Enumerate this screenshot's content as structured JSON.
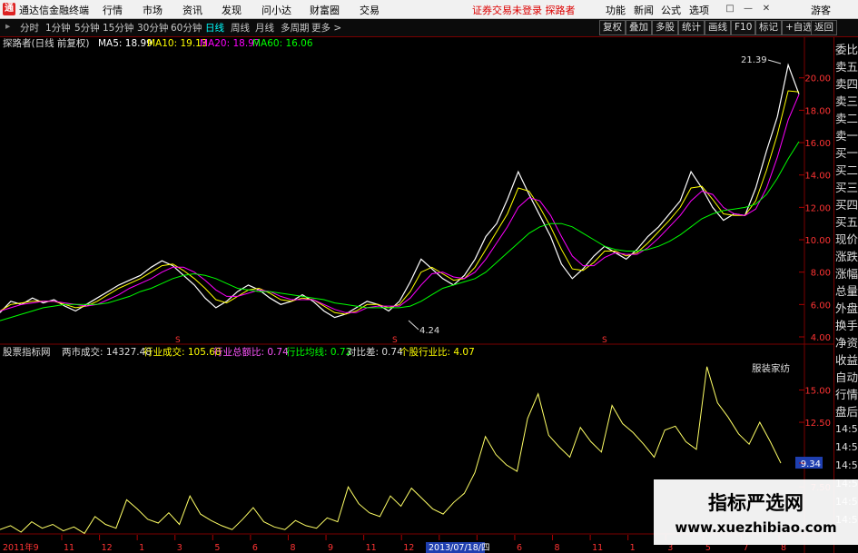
{
  "app": {
    "logo_char": "通",
    "name": "通达信金融终端"
  },
  "menu": [
    "行情",
    "市场",
    "资讯",
    "发现",
    "问小达",
    "财富圈",
    "交易"
  ],
  "notice": "证券交易未登录  探路者",
  "right_menu": [
    "功能",
    "新闻",
    "公式",
    "选项"
  ],
  "guest_label": "游客",
  "window_buttons": [
    "□",
    "—",
    "✕"
  ],
  "periods": [
    "分时",
    "1分钟",
    "5分钟",
    "15分钟",
    "30分钟",
    "60分钟",
    "日线",
    "周线",
    "月线",
    "多周期",
    "更多 >"
  ],
  "active_period": "日线",
  "tools": [
    "复权",
    "叠加",
    "多股",
    "统计",
    "画线",
    "F10",
    "标记",
    "+自选",
    "返回"
  ],
  "main_legend": {
    "stock": "探路者(日线 前复权)",
    "ma": [
      {
        "label": "MA5: 18.99",
        "color": "#ffffff"
      },
      {
        "label": "MA10: 19.13",
        "color": "#ffff00"
      },
      {
        "label": "MA20: 18.97",
        "color": "#ff00ff"
      },
      {
        "label": "MA60: 16.06",
        "color": "#00ff00"
      }
    ]
  },
  "price_axis": [
    "20.00",
    "18.00",
    "16.00",
    "14.00",
    "12.00",
    "10.00",
    "8.00",
    "6.00",
    "4.00"
  ],
  "annotations": {
    "high": "21.39",
    "low": "4.24"
  },
  "sub_legend": {
    "name": "股票指标网",
    "items": [
      {
        "label": "两市成交: 14327.48",
        "color": "#dddddd"
      },
      {
        "label": "行业成交: 105.68",
        "color": "#ffff00"
      },
      {
        "label": "行业总额比: 0.74",
        "color": "#ff55ff"
      },
      {
        "label": "行比均线: 0.72",
        "color": "#00ff00"
      },
      {
        "label": "对比差: 0.74",
        "color": "#dddddd"
      },
      {
        "label": "个股行业比: 4.07",
        "color": "#ffff00"
      }
    ]
  },
  "industry_label": "服装家纺",
  "sub_axis": [
    "15.00",
    "12.50",
    "9.34",
    "7.50"
  ],
  "sub_axis_current": "9.34",
  "x_axis": {
    "left_label": "2011年9",
    "labels": [
      "11",
      "12",
      "1",
      "3",
      "5",
      "6",
      "8",
      "9",
      "11",
      "12",
      "2",
      "4",
      "6",
      "8",
      "11",
      "1",
      "3",
      "5",
      "7",
      "8"
    ],
    "cursor_date": "2013/07/18/四"
  },
  "side_panel": [
    "委比",
    "卖五",
    "卖四",
    "卖三",
    "卖二",
    "卖一",
    "买一",
    "买二",
    "买三",
    "买四",
    "买五",
    "现价",
    "涨跌",
    "涨幅",
    "总量",
    "外盘",
    "换手",
    "净资",
    "收益",
    "自动",
    "行情",
    "盘后"
  ],
  "side_times": [
    "14:50",
    "14:50",
    "14:50",
    "14:50",
    "14:50",
    "14:50"
  ],
  "watermark": {
    "line1": "指标严选网",
    "line2": "www.xuezhibiao.com"
  },
  "chart_data": {
    "type": "line",
    "price_series": [
      {
        "name": "MA5",
        "values": [
          5.5,
          6.2,
          6.0,
          6.4,
          6.1,
          6.3,
          5.9,
          5.6,
          6.0,
          6.4,
          6.8,
          7.2,
          7.5,
          7.8,
          8.3,
          8.7,
          8.4,
          7.8,
          7.2,
          6.4,
          5.8,
          6.2,
          6.8,
          7.2,
          6.9,
          6.4,
          6.0,
          6.2,
          6.6,
          6.2,
          5.6,
          5.2,
          5.4,
          5.8,
          6.2,
          6.0,
          5.6,
          6.2,
          7.4,
          8.8,
          8.2,
          7.6,
          7.2,
          7.8,
          8.8,
          10.2,
          11.0,
          12.5,
          14.2,
          12.8,
          11.5,
          10.2,
          8.5,
          7.6,
          8.2,
          9.0,
          9.6,
          9.2,
          8.8,
          9.4,
          10.2,
          10.8,
          11.6,
          12.4,
          14.2,
          13.2,
          12.0,
          11.2,
          11.6,
          11.5,
          13.2,
          15.5,
          17.6,
          20.8,
          18.99
        ]
      },
      {
        "name": "MA10",
        "values": [
          5.6,
          6.0,
          6.1,
          6.2,
          6.2,
          6.2,
          6.0,
          5.8,
          5.9,
          6.2,
          6.6,
          7.0,
          7.3,
          7.6,
          8.0,
          8.4,
          8.5,
          8.1,
          7.6,
          7.0,
          6.3,
          6.1,
          6.5,
          6.9,
          7.0,
          6.7,
          6.3,
          6.2,
          6.4,
          6.3,
          5.9,
          5.5,
          5.4,
          5.6,
          6.0,
          6.0,
          5.8,
          6.0,
          6.8,
          8.0,
          8.3,
          7.9,
          7.5,
          7.6,
          8.3,
          9.4,
          10.5,
          11.6,
          13.2,
          13.0,
          12.0,
          10.8,
          9.4,
          8.2,
          8.1,
          8.6,
          9.3,
          9.3,
          9.0,
          9.2,
          9.8,
          10.5,
          11.2,
          12.0,
          13.2,
          13.3,
          12.5,
          11.6,
          11.5,
          11.5,
          12.4,
          14.3,
          16.5,
          19.2,
          19.13
        ]
      },
      {
        "name": "MA20",
        "values": [
          5.6,
          5.8,
          6.0,
          6.1,
          6.2,
          6.2,
          6.1,
          6.0,
          5.9,
          6.0,
          6.3,
          6.6,
          7.0,
          7.3,
          7.6,
          8.0,
          8.3,
          8.3,
          8.0,
          7.5,
          6.9,
          6.5,
          6.5,
          6.7,
          6.9,
          6.8,
          6.5,
          6.3,
          6.3,
          6.3,
          6.0,
          5.7,
          5.5,
          5.5,
          5.8,
          5.9,
          5.9,
          5.9,
          6.4,
          7.2,
          7.9,
          8.0,
          7.7,
          7.6,
          8.0,
          8.8,
          9.8,
          10.8,
          12.0,
          12.6,
          12.4,
          11.5,
          10.2,
          9.0,
          8.4,
          8.4,
          8.9,
          9.2,
          9.1,
          9.1,
          9.5,
          10.1,
          10.8,
          11.5,
          12.4,
          13.0,
          12.8,
          12.0,
          11.6,
          11.5,
          11.9,
          13.2,
          15.1,
          17.4,
          18.97
        ]
      },
      {
        "name": "MA60",
        "values": [
          5.0,
          5.2,
          5.4,
          5.6,
          5.8,
          5.9,
          6.0,
          6.0,
          6.0,
          6.0,
          6.1,
          6.3,
          6.5,
          6.8,
          7.0,
          7.3,
          7.6,
          7.8,
          7.9,
          7.8,
          7.6,
          7.3,
          7.0,
          6.9,
          6.8,
          6.8,
          6.7,
          6.6,
          6.5,
          6.4,
          6.3,
          6.1,
          6.0,
          5.9,
          5.8,
          5.8,
          5.8,
          5.8,
          5.9,
          6.2,
          6.6,
          7.0,
          7.2,
          7.4,
          7.6,
          8.0,
          8.6,
          9.2,
          9.8,
          10.4,
          10.8,
          11.0,
          11.0,
          10.8,
          10.4,
          10.0,
          9.6,
          9.4,
          9.3,
          9.3,
          9.4,
          9.6,
          9.9,
          10.3,
          10.8,
          11.3,
          11.6,
          11.8,
          11.9,
          12.0,
          12.2,
          12.8,
          13.8,
          15.0,
          16.06
        ]
      }
    ],
    "volume_ratio": [
      4.2,
      4.5,
      4.0,
      4.8,
      4.3,
      4.6,
      4.1,
      4.4,
      3.9,
      5.2,
      4.6,
      4.3,
      6.5,
      5.8,
      5.0,
      4.7,
      5.5,
      4.6,
      6.8,
      5.4,
      4.9,
      4.5,
      4.2,
      5.0,
      5.9,
      4.8,
      4.4,
      4.2,
      4.9,
      4.5,
      4.3,
      5.1,
      4.8,
      7.5,
      6.2,
      5.5,
      5.2,
      6.8,
      6.0,
      7.4,
      6.6,
      5.8,
      5.4,
      6.3,
      7.0,
      8.6,
      11.4,
      10.0,
      9.2,
      8.7,
      12.8,
      14.7,
      11.5,
      10.6,
      9.8,
      12.1,
      11.0,
      10.2,
      13.8,
      12.4,
      11.7,
      10.8,
      9.8,
      11.9,
      12.2,
      11.0,
      10.4,
      16.8,
      14.0,
      12.9,
      11.6,
      10.8,
      12.5,
      11.0,
      9.34
    ],
    "ylim_price": [
      4.0,
      21.5
    ],
    "ylim_sub": [
      4.0,
      17.0
    ]
  }
}
